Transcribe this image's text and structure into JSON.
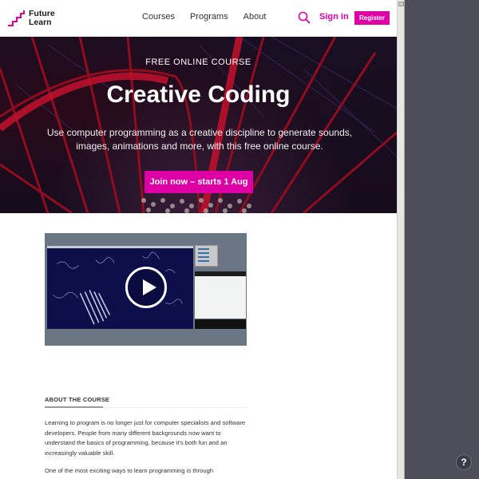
{
  "header": {
    "logo_line1": "Future",
    "logo_line2": "Learn",
    "nav": [
      "Courses",
      "Programs",
      "About"
    ],
    "search_icon": "search-icon",
    "signin_label": "Sign in",
    "register_label": "Register"
  },
  "hero": {
    "eyebrow": "FREE ONLINE COURSE",
    "title": "Creative Coding",
    "description": "Use computer programming as a creative discipline to generate sounds, images, animations and more, with this free online course.",
    "cta_label": "Join now – starts 1 Aug"
  },
  "video": {
    "play_icon": "play-icon"
  },
  "about": {
    "heading": "ABOUT THE COURSE",
    "paragraphs": [
      "Learning to program is no longer just for computer specialists and software developers. People from many different backgrounds now want to understand the basics of programming, because it's both fun and an increasingly valuable skill.",
      "One of the most exciting ways to learn programming is through"
    ]
  },
  "help": {
    "label": "?"
  },
  "colors": {
    "brand": "#de00a5",
    "side_background": "#4c4f5a",
    "video_frame": "#6b7685"
  }
}
